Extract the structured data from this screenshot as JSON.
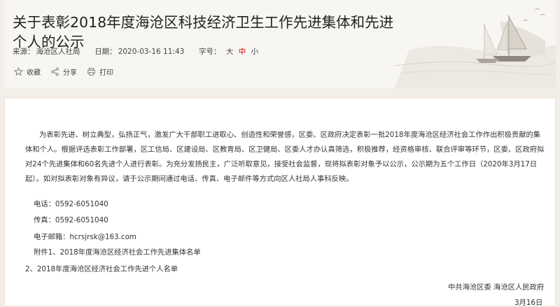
{
  "article": {
    "title": "关于表彰2018年度海沧区科技经济卫生工作先进集体和先进个人的公示",
    "source_label": "来源：",
    "source": "海沧区人社局",
    "date_label": "日期：",
    "date": "2020-03-16 11:43",
    "font_label": "字号：",
    "font_sizes": [
      "大",
      "中",
      "小"
    ],
    "actions": {
      "favorite": "收藏",
      "share": "分享",
      "print": "打印"
    }
  },
  "body": {
    "paragraph": "为表彰先进、树立典型，弘扬正气，激发广大干部职工进取心、创造性和荣誉感，区委、区政府决定表彰一批2018年度海沧区经济社会工作作出积极贡献的集体和个人。根据评选表彰工作部署，区工信局、区建设局、区教育局、区卫健局、区委人才办认真筛选，积极推荐，经资格审核、联合评审等环节，区委、区政府拟对24个先进集体和60名先进个人进行表彰。为充分发扬民主，广泛听取意见，接受社会监督，现将拟表彰对象予以公示，公示期为五个工作日（2020年3月17日起）。如对拟表彰对象有异议，请于公示期间通过电话、传真、电子邮件等方式向区人社局人事科反映。",
    "phone": "电话：0592-6051040",
    "fax": "传真：0592-6051040",
    "email": "电子邮箱：hcrsjrsk@163.com",
    "attachment1": "附件1、2018年度海沧区经济社会工作先进集体名单",
    "attachment2": "2、2018年度海沧区经济社会工作先进个人名单",
    "signature": "中共海沧区委  海沧区人民政府",
    "sign_date": "3月16日"
  }
}
